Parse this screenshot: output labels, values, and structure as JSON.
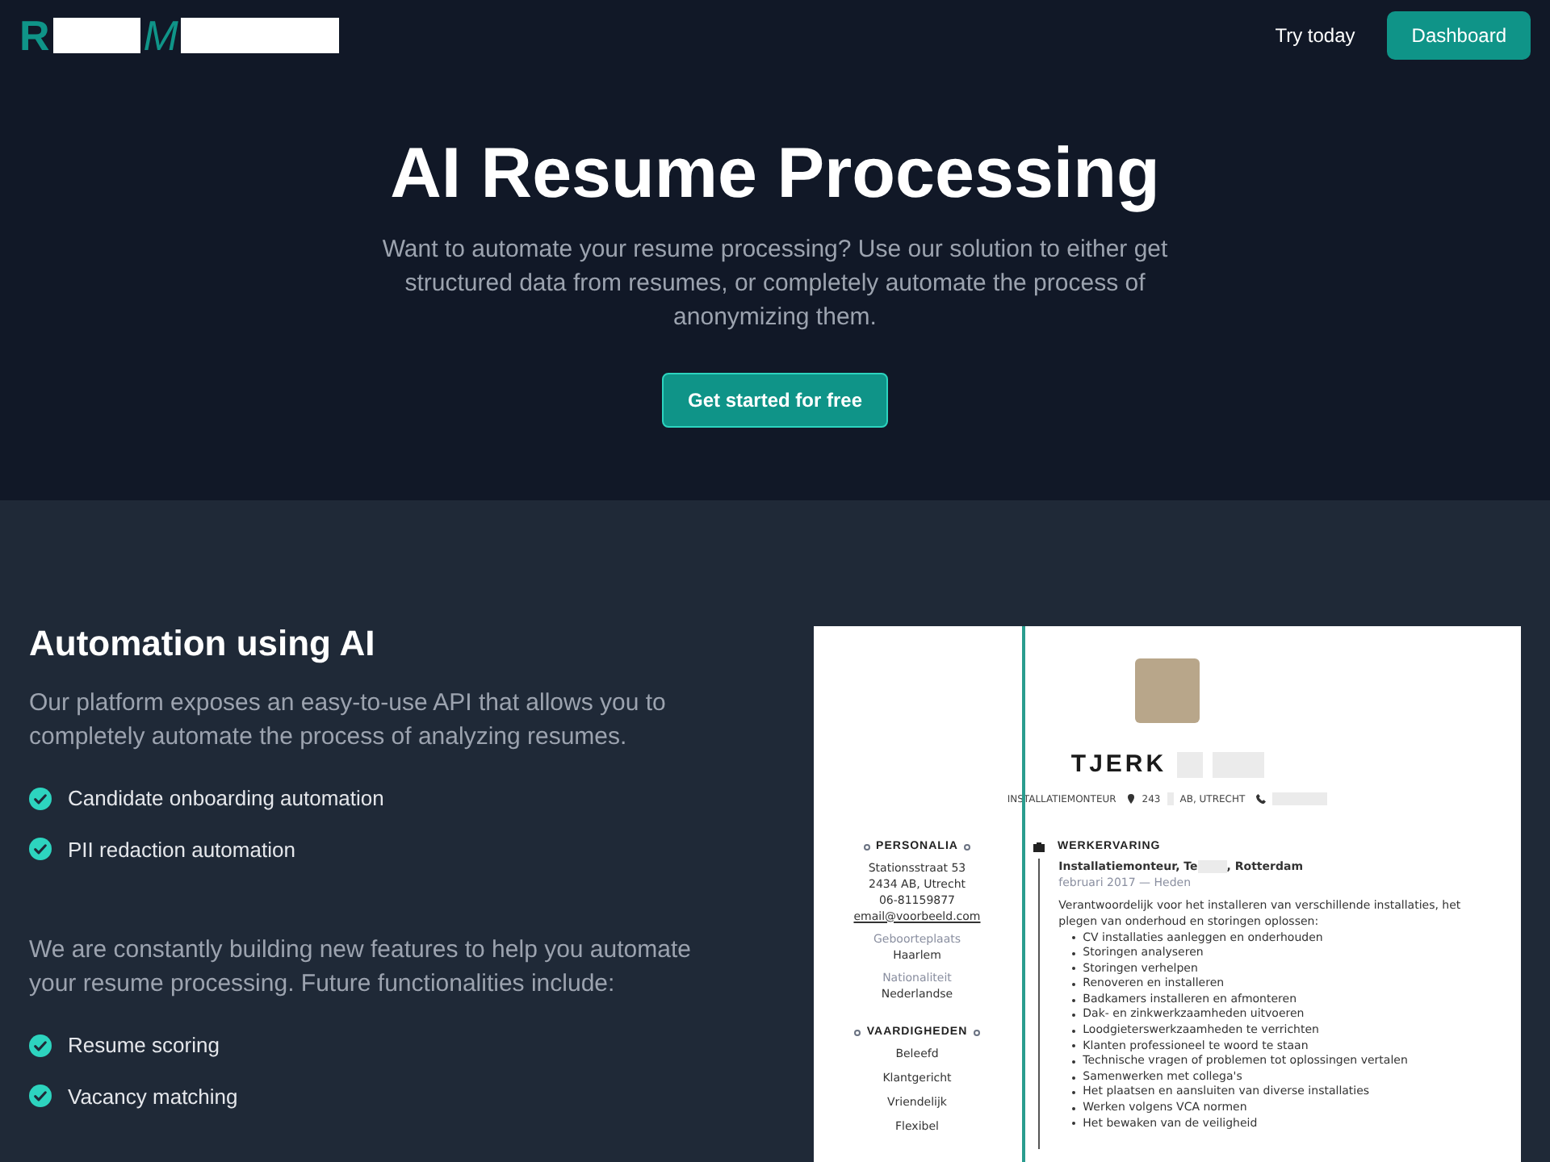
{
  "nav": {
    "logo_letters": [
      "R",
      "M"
    ],
    "link": "Try today",
    "button": "Dashboard"
  },
  "hero": {
    "title": "AI Resume Processing",
    "subtitle": "Want to automate your resume processing? Use our solution to either get structured data from resumes, or completely automate the process of anonymizing them.",
    "cta": "Get started for free"
  },
  "features": {
    "heading": "Automation using AI",
    "intro": "Our platform exposes an easy-to-use API that allows you to completely automate the process of analyzing resumes.",
    "items": [
      "Candidate onboarding automation",
      "PII redaction automation"
    ],
    "future_intro": "We are constantly building new features to help you automate your resume processing. Future functionalities include:",
    "future_items": [
      "Resume scoring",
      "Vacancy matching"
    ]
  },
  "resume": {
    "name": "TJERK",
    "headline": "INSTALLATIEMONTEUR",
    "address_start": "243",
    "address_end": "AB, UTRECHT",
    "personalia": {
      "heading": "PERSONALIA",
      "lines": [
        "Stationsstraat 53",
        "2434 AB, Utrecht",
        "06-81159877"
      ],
      "email": "email@voorbeeld.com",
      "fields": [
        {
          "label": "Geboorteplaats",
          "value": "Haarlem"
        },
        {
          "label": "Nationaliteit",
          "value": "Nederlandse"
        }
      ]
    },
    "skills": {
      "heading": "VAARDIGHEDEN",
      "items": [
        "Beleefd",
        "Klantgericht",
        "Vriendelijk",
        "Flexibel"
      ]
    },
    "experience": {
      "heading": "WERKERVARING",
      "job_start": "Installatiemonteur, Te",
      "job_end": ", Rotterdam",
      "period": "februari 2017 — Heden",
      "description": "Verantwoordelijk voor het installeren van verschillende installaties, het plegen van onderhoud en storingen oplossen:",
      "bullets": [
        "CV installaties aanleggen en onderhouden",
        "Storingen analyseren",
        "Storingen verhelpen",
        "Renoveren en installeren",
        "Badkamers installeren en afmonteren",
        "Dak- en zinkwerkzaamheden uitvoeren",
        "Loodgieterswerkzaamheden te verrichten",
        "Klanten professioneel te woord te staan",
        "Technische vragen of problemen tot oplossingen vertalen",
        "Samenwerken met collega's",
        "Het plaatsen en aansluiten van diverse installaties",
        "Werken volgens VCA normen",
        "Het bewaken van de veiligheid"
      ]
    }
  }
}
